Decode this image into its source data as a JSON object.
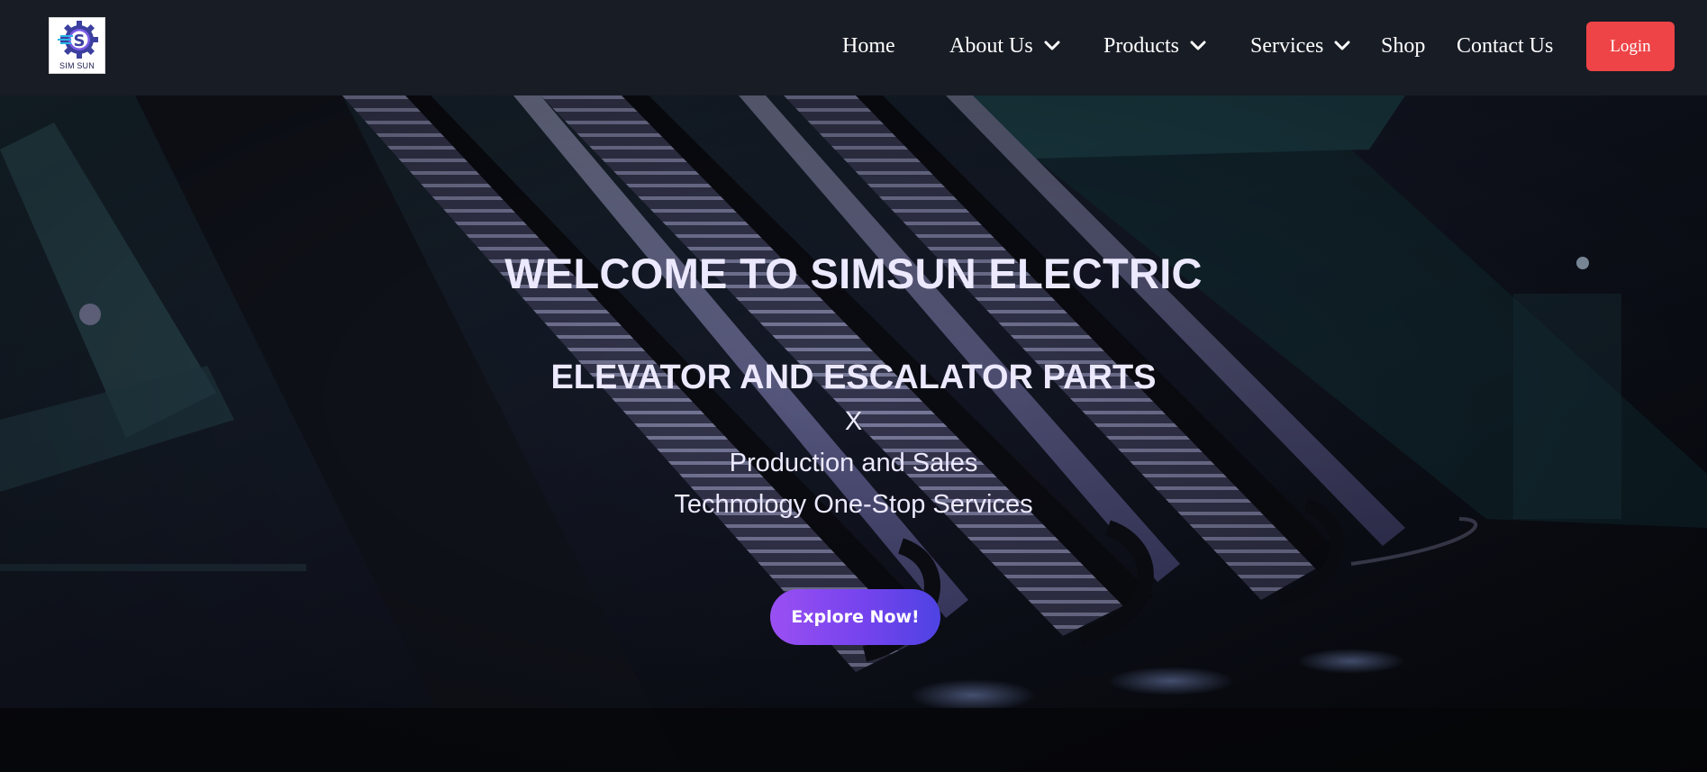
{
  "brand": {
    "logo_text": "SIM SUN",
    "logo_letter": "S",
    "colors": {
      "navbar_bg": "#181c25",
      "login_bg": "#ee4447",
      "button_gradient_start": "#9a50f2",
      "button_gradient_end": "#4e43e3"
    }
  },
  "nav": {
    "home": "Home",
    "about": "About Us",
    "products": "Products",
    "services": "Services",
    "shop": "Shop",
    "contact": "Contact Us",
    "login": "Login",
    "dropdown_icon": "chevron-down-icon"
  },
  "hero": {
    "background": "escalator-photo",
    "title": "WELCOME TO SIMSUN ELECTRIC",
    "subtitle": "ELEVATOR AND ESCALATOR PARTS",
    "separator": "X",
    "line1": "Production and Sales",
    "line2": "Technology One-Stop Services",
    "cta": "Explore Now!"
  }
}
